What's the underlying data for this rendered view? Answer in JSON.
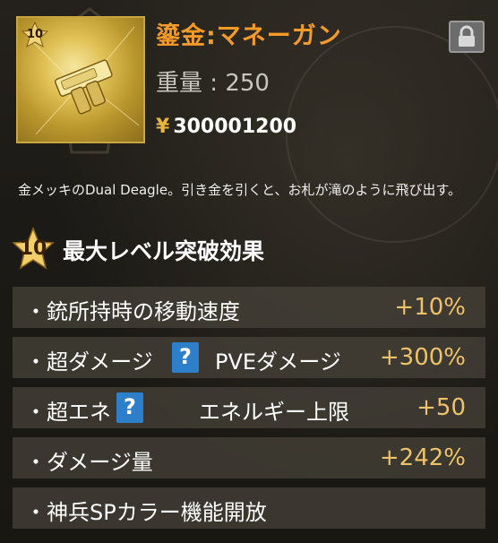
{
  "item": {
    "level_badge": "10",
    "name": "鎏金:マネーガン",
    "weight_label": "重量",
    "weight_sep": ":",
    "weight_value": "250",
    "price_symbol": "¥",
    "price": "300001200",
    "description": "金メッキのDual Deagle。引き金を引くと、お札が滝のように飛び出す。"
  },
  "section": {
    "badge": "10",
    "title": "最大レベル突破効果"
  },
  "effects": [
    {
      "label": "・銃所持時の移動速度",
      "value": "+10%"
    },
    {
      "label": "・超ダメージ",
      "help": "?",
      "sub": "PVEダメージ",
      "value": "+300%"
    },
    {
      "label": "・超エネ",
      "help": "?",
      "sub": "エネルギー上限",
      "value": "+50"
    },
    {
      "label": "・ダメージ量",
      "value": "+242%"
    },
    {
      "label": "・神兵SPカラー機能開放"
    }
  ],
  "icons": {
    "lock": "lock-icon",
    "help": "question-icon",
    "badge": "star-badge-icon"
  },
  "colors": {
    "name": "#f29a2a",
    "value": "#eec26a",
    "help": "#2e7fc9",
    "border": "#c9a640"
  }
}
